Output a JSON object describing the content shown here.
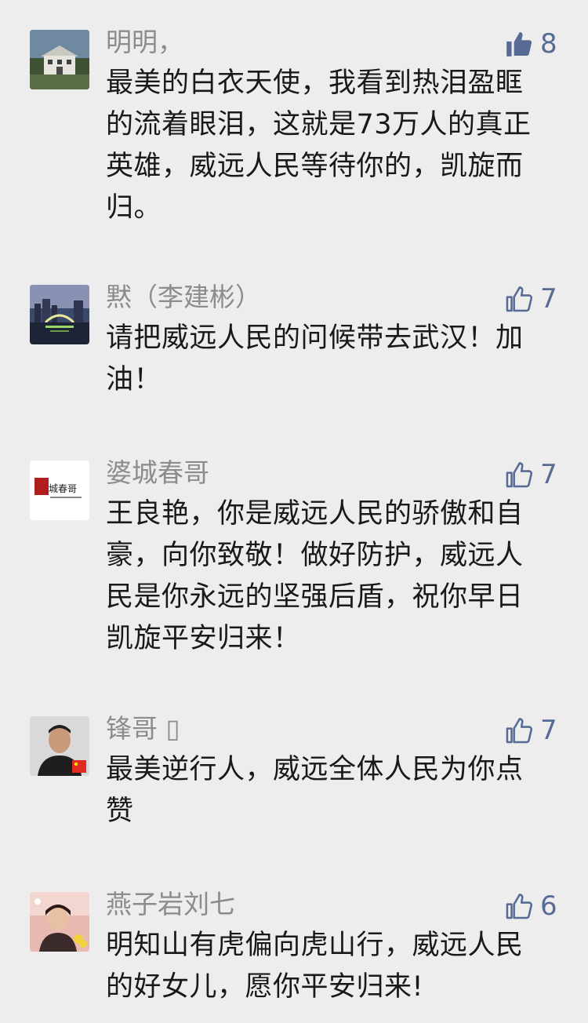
{
  "comments": [
    {
      "author": "明明，",
      "likes": "8",
      "liked": true,
      "avatar_icon": "house-photo-icon",
      "text": "最美的白衣天使，我看到热泪盈眶的流着眼泪，这就是73万人的真正英雄，威远人民等待你的，凯旋而归。"
    },
    {
      "author": "黙（李建彬）",
      "likes": "7",
      "liked": false,
      "avatar_icon": "city-night-photo-icon",
      "text": "请把威远人民的问候带去武汉！加油！"
    },
    {
      "author": "婆城春哥",
      "likes": "7",
      "liked": false,
      "avatar_icon": "logo-avatar-icon",
      "avatar_logo_text": "婆城春哥",
      "text": "王良艳，你是威远人民的骄傲和自豪，向你致敬！做好防护，威远人民是你永远的坚强后盾，祝你早日凯旋平安归来！"
    },
    {
      "author": "锋哥 ▯",
      "likes": "7",
      "liked": false,
      "avatar_icon": "portrait-photo-icon",
      "text": "最美逆行人，威远全体人民为你点赞"
    },
    {
      "author": "燕子岩刘七",
      "likes": "6",
      "liked": false,
      "avatar_icon": "portrait-flowers-photo-icon",
      "text": "明知山有虎偏向虎山行，威远人民的好女儿，愿你平安归来!"
    }
  ],
  "colors": {
    "background": "#ededed",
    "author": "#8c8c8c",
    "body_text": "#191919",
    "like_accent": "#576b95"
  }
}
